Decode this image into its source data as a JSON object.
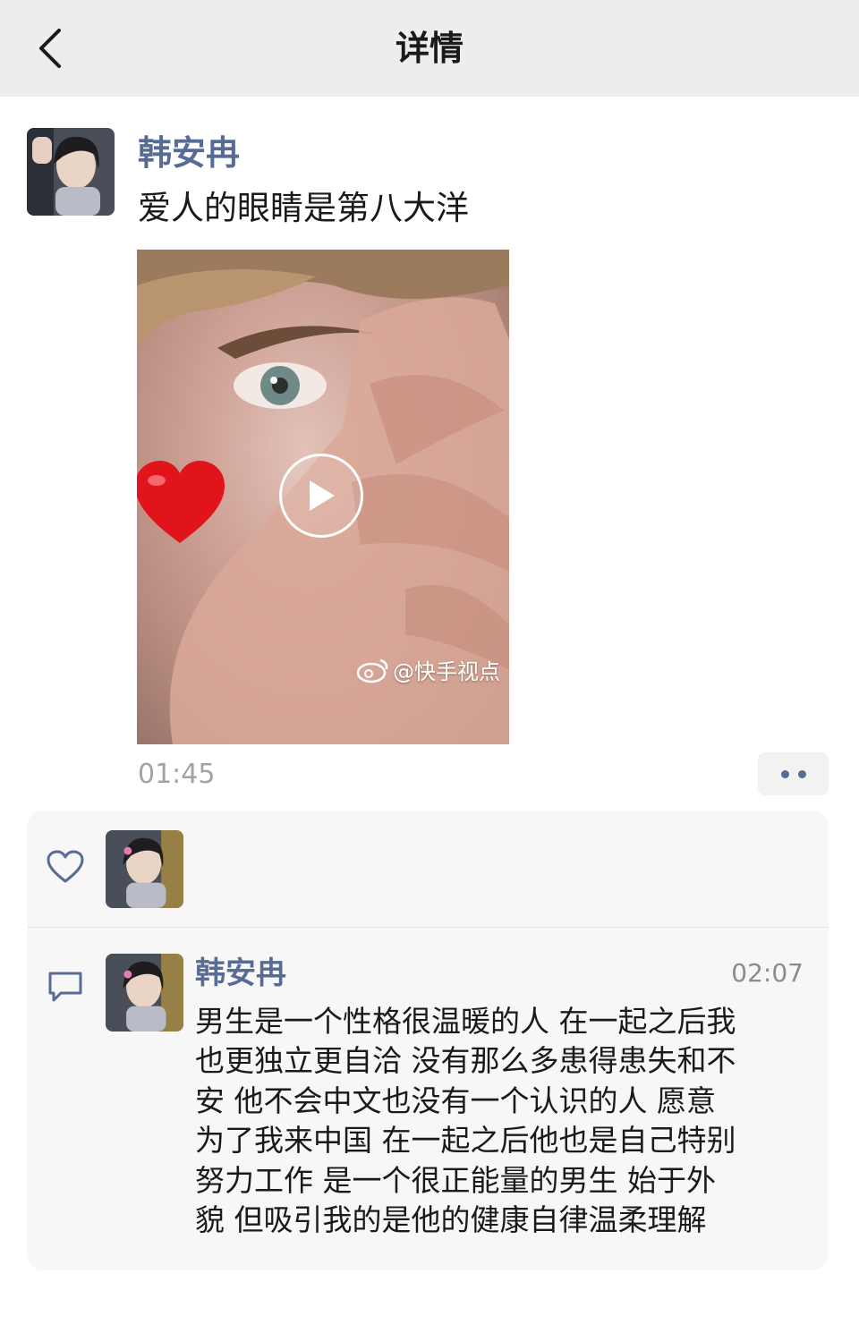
{
  "nav": {
    "title": "详情",
    "back_icon": "chevron-left-icon"
  },
  "post": {
    "author": "韩安冉",
    "text": "爱人的眼睛是第八大洋",
    "video": {
      "watermark": "@快手视点",
      "play_icon": "play-icon",
      "sticker_icon": "heart-icon"
    },
    "time": "01:45",
    "more_icon": "more-dots-icon"
  },
  "likes": {
    "icon": "heart-outline-icon",
    "count_avatars": 1
  },
  "comments": [
    {
      "author": "韩安冉",
      "time": "02:07",
      "text": "男生是一个性格很温暖的人 在一起之后我\n也更独立更自洽 没有那么多患得患失和不\n安  他不会中文也没有一个认识的人 愿意\n为了我来中国 在一起之后他也是自己特别\n努力工作 是一个很正能量的男生 始于外\n貌 但吸引我的是他的健康自律温柔理解"
    }
  ],
  "colors": {
    "link_blue": "#576b95",
    "nav_bg": "#ededed",
    "panel_bg": "#f7f7f7"
  }
}
